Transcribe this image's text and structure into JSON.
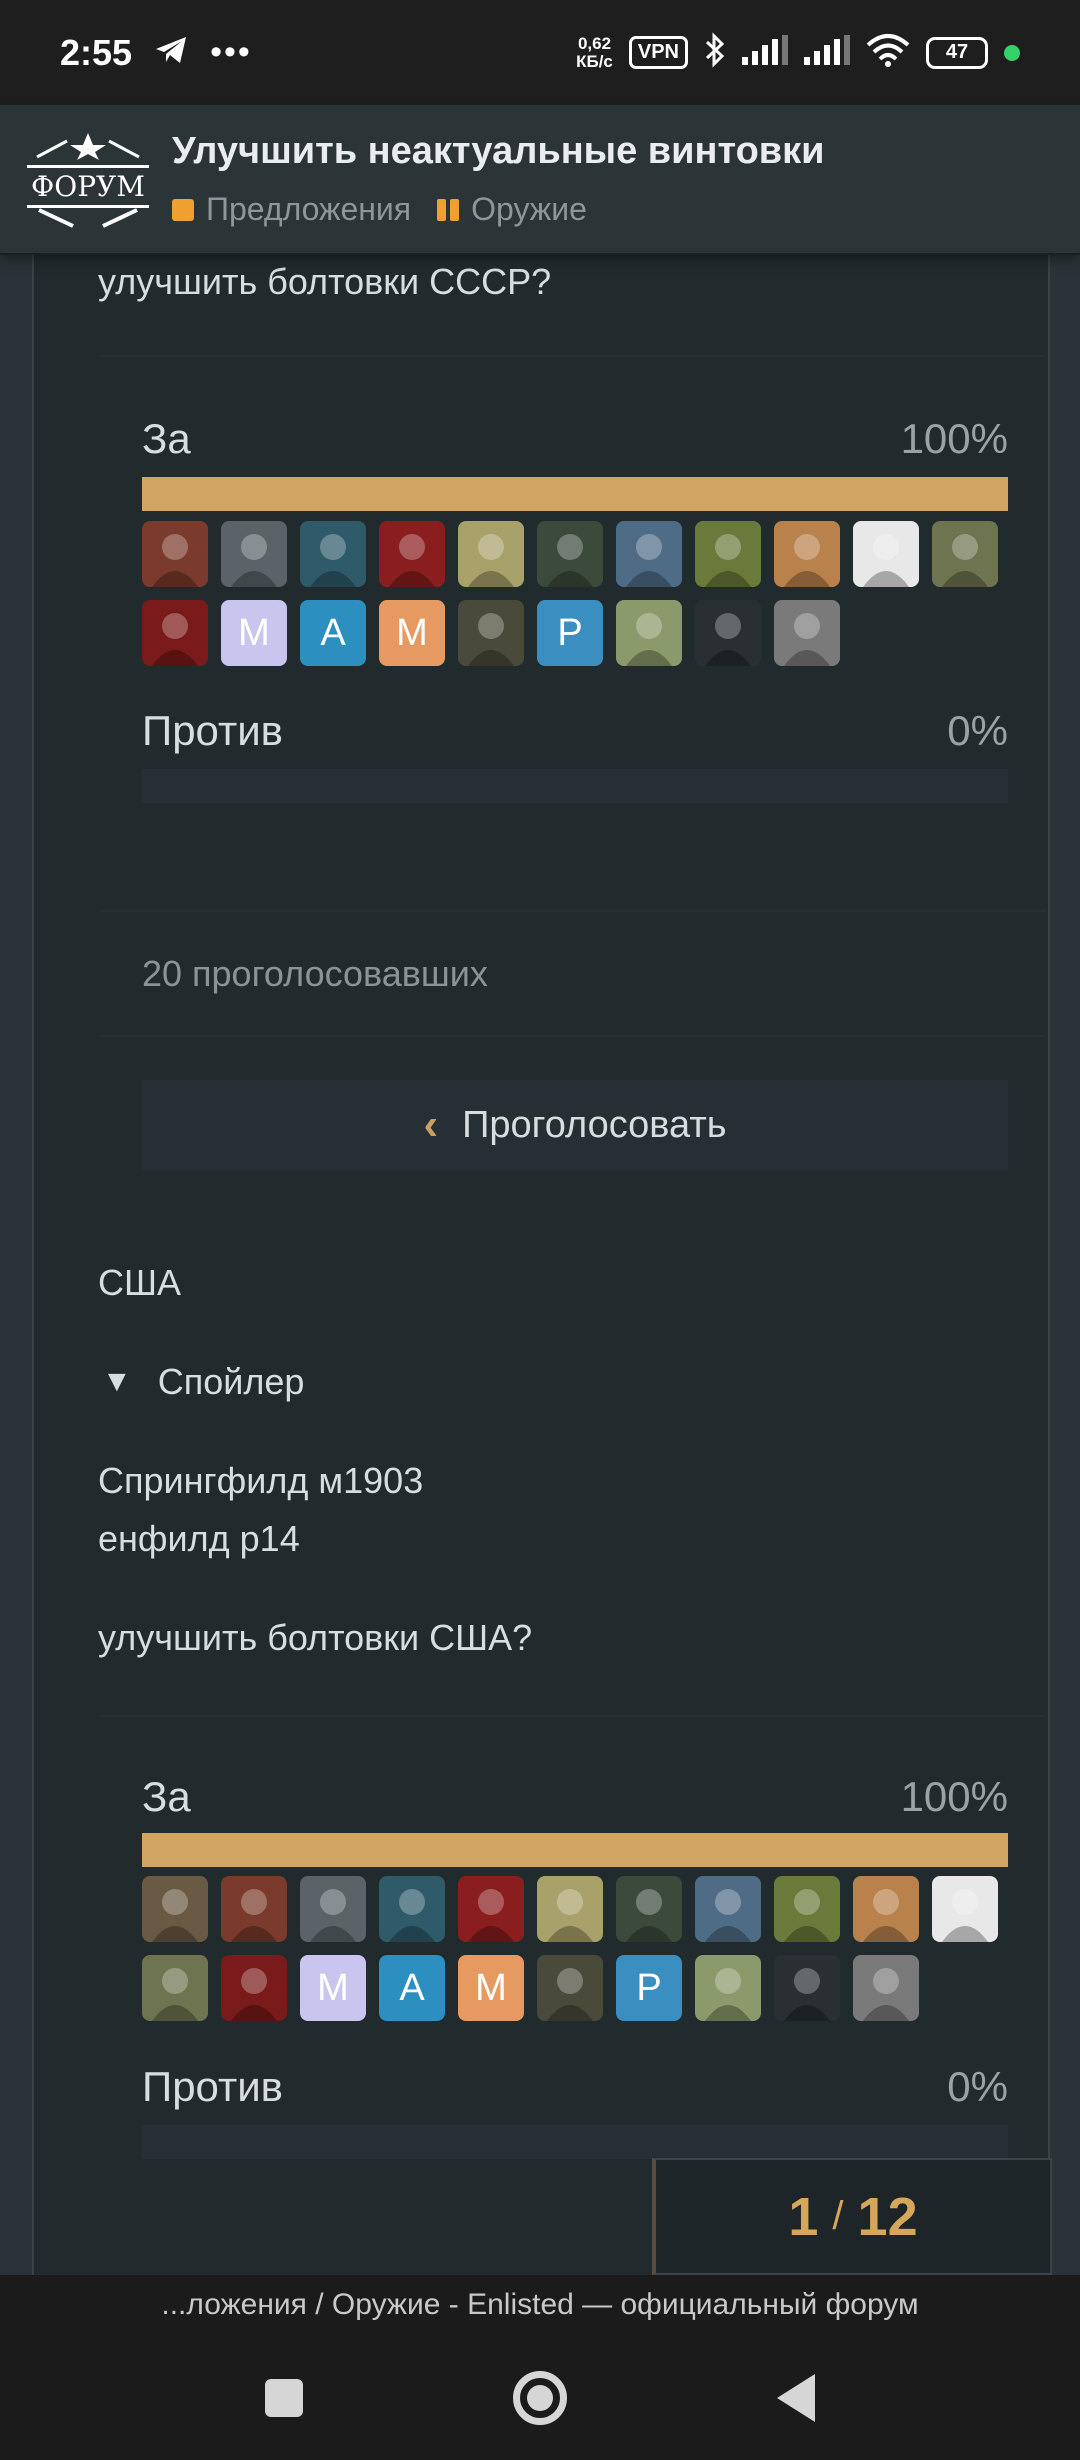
{
  "status_bar": {
    "time": "2:55",
    "speed_value": "0,62",
    "speed_unit": "КБ/с",
    "vpn": "VPN",
    "battery": "47"
  },
  "header": {
    "logo_text": "ФОРУМ",
    "title": "Улучшить неактуальные винтовки",
    "crumb_1": "Предложения",
    "crumb_2": "Оружие"
  },
  "post": {
    "question_ussr": "улучшить болтовки СССР?",
    "section_usa": "США",
    "spoiler_label": "Спойлер",
    "rifle_1": "Спрингфилд м1903",
    "rifle_2": "енфилд р14",
    "question_usa": "улучшить болтовки США?"
  },
  "poll_ussr": {
    "option_for": "За",
    "pct_for": "100%",
    "fill_for": 1.0,
    "option_against": "Против",
    "pct_against": "0%",
    "voters": "20 проголосовавших",
    "vote_button": "Проголосовать",
    "avatars": [
      {
        "icon": "avatar-soldier-red",
        "letter": "",
        "color": "#7a3a2c"
      },
      {
        "icon": "avatar-polar-bear",
        "letter": "",
        "color": "#5a6468"
      },
      {
        "icon": "avatar-pilot",
        "letter": "",
        "color": "#2f5a6a"
      },
      {
        "icon": "avatar-dark-soldier",
        "letter": "",
        "color": "#8a1e1e"
      },
      {
        "icon": "avatar-figurine",
        "letter": "",
        "color": "#a8a16a"
      },
      {
        "icon": "avatar-camo-soldier",
        "letter": "",
        "color": "#3c4a3c"
      },
      {
        "icon": "avatar-warship",
        "letter": "",
        "color": "#4f6c86"
      },
      {
        "icon": "avatar-frog",
        "letter": "",
        "color": "#6a7a3a"
      },
      {
        "icon": "avatar-bearded-man",
        "letter": "",
        "color": "#b9824c"
      },
      {
        "icon": "avatar-sketch",
        "letter": "",
        "color": "#e8e8e8"
      },
      {
        "icon": "avatar-rifleman",
        "letter": "",
        "color": "#6e7450"
      },
      {
        "icon": "avatar-demon-mask",
        "letter": "",
        "color": "#7a1a1a"
      },
      {
        "icon": "avatar-letter",
        "letter": "M",
        "color": "#c9c5ee"
      },
      {
        "icon": "avatar-letter",
        "letter": "A",
        "color": "#2d8fbf"
      },
      {
        "icon": "avatar-letter",
        "letter": "M",
        "color": "#e69a62"
      },
      {
        "icon": "avatar-gasmask",
        "letter": "",
        "color": "#4a4a3a"
      },
      {
        "icon": "avatar-letter",
        "letter": "P",
        "color": "#3a8ec0"
      },
      {
        "icon": "avatar-anime-girl",
        "letter": "",
        "color": "#8a9a6a"
      },
      {
        "icon": "avatar-officer",
        "letter": "",
        "color": "#2a2f33"
      },
      {
        "icon": "avatar-cat",
        "letter": "",
        "color": "#7a7a7a"
      }
    ]
  },
  "poll_usa": {
    "option_for": "За",
    "pct_for": "100%",
    "fill_for": 1.0,
    "option_against": "Против",
    "pct_against": "0%",
    "avatars": [
      {
        "icon": "avatar-cat-soldier",
        "letter": "",
        "color": "#6a5a44"
      },
      {
        "icon": "avatar-soldier-red",
        "letter": "",
        "color": "#7a3a2c"
      },
      {
        "icon": "avatar-polar-bear",
        "letter": "",
        "color": "#5a6468"
      },
      {
        "icon": "avatar-pilot",
        "letter": "",
        "color": "#2f5a6a"
      },
      {
        "icon": "avatar-dark-soldier",
        "letter": "",
        "color": "#8a1e1e"
      },
      {
        "icon": "avatar-figurine",
        "letter": "",
        "color": "#a8a16a"
      },
      {
        "icon": "avatar-camo-soldier",
        "letter": "",
        "color": "#3c4a3c"
      },
      {
        "icon": "avatar-warship",
        "letter": "",
        "color": "#4f6c86"
      },
      {
        "icon": "avatar-frog",
        "letter": "",
        "color": "#6a7a3a"
      },
      {
        "icon": "avatar-bearded-man",
        "letter": "",
        "color": "#b9824c"
      },
      {
        "icon": "avatar-sketch",
        "letter": "",
        "color": "#e8e8e8"
      },
      {
        "icon": "avatar-rifleman",
        "letter": "",
        "color": "#6e7450"
      },
      {
        "icon": "avatar-demon-mask",
        "letter": "",
        "color": "#7a1a1a"
      },
      {
        "icon": "avatar-letter",
        "letter": "M",
        "color": "#c9c5ee"
      },
      {
        "icon": "avatar-letter",
        "letter": "A",
        "color": "#2d8fbf"
      },
      {
        "icon": "avatar-letter",
        "letter": "M",
        "color": "#e69a62"
      },
      {
        "icon": "avatar-gasmask",
        "letter": "",
        "color": "#4a4a3a"
      },
      {
        "icon": "avatar-letter",
        "letter": "P",
        "color": "#3a8ec0"
      },
      {
        "icon": "avatar-anime-girl",
        "letter": "",
        "color": "#8a9a6a"
      },
      {
        "icon": "avatar-officer",
        "letter": "",
        "color": "#2a2f33"
      },
      {
        "icon": "avatar-cat",
        "letter": "",
        "color": "#7a7a7a"
      }
    ]
  },
  "progress": {
    "current": "1",
    "total": "12"
  },
  "browser": {
    "url_text": "...ложения / Оружие - Enlisted — официальный форум"
  }
}
